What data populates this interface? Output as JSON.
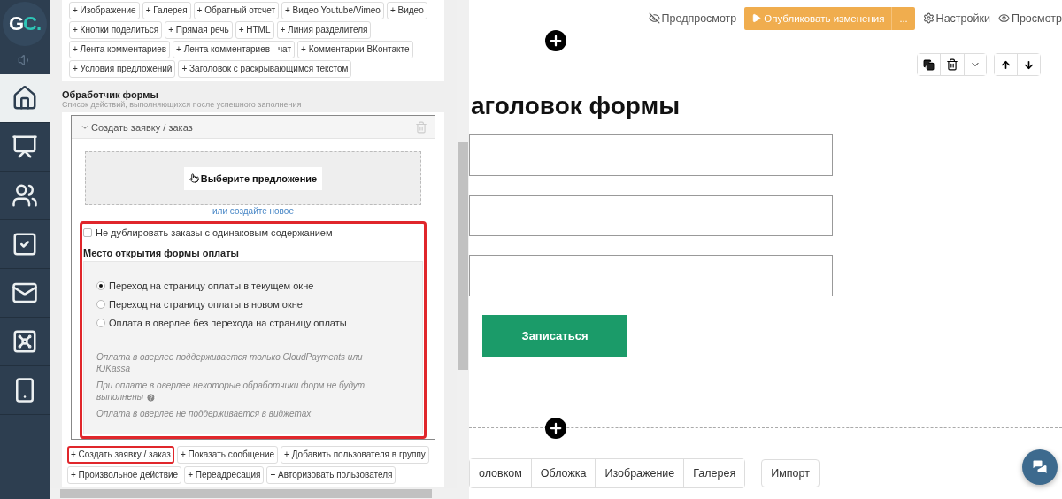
{
  "logo": {
    "text": "GC."
  },
  "nav": [
    {
      "selected": true
    },
    {
      "selected": false
    },
    {
      "selected": false
    },
    {
      "selected": false
    },
    {
      "selected": false
    },
    {
      "selected": false
    },
    {
      "selected": false
    }
  ],
  "block_buttons": [
    [
      "+ Изображение",
      "+ Галерея",
      "+ Обратный отсчет",
      "+ Видео Youtube/Vimeo",
      "+ Видео"
    ],
    [
      "+ Кнопки поделиться",
      "+ Прямая речь",
      "+ HTML",
      "+ Линия разделителя"
    ],
    [
      "+ Лента комментариев",
      "+ Лента комментариев - чат",
      "+ Комментарии ВКонтакте"
    ],
    [
      "+ Условия предложений",
      "+ Заголовок с раскрывающимся текстом"
    ]
  ],
  "form_handler": {
    "title": "Обработчик формы",
    "subtitle": "Список действий, выполняющихся после успешного заполнения",
    "action": {
      "title": "Создать заявку / заказ",
      "expanded": true,
      "choose_button": "Выберите предложение",
      "create_link": "или создайте новое",
      "settings": {
        "highlighted": true,
        "no_duplicates": {
          "label": "Не дублировать заказы с одинаковым содержанием",
          "checked": false
        },
        "payment_title": "Место открытия формы оплаты",
        "options": [
          {
            "label": "Переход на страницу оплаты в текущем окне",
            "selected": true
          },
          {
            "label": "Переход на страницу оплаты в новом окне",
            "selected": false
          },
          {
            "label": "Оплата в оверлее без перехода на страницу оплаты",
            "selected": false
          }
        ],
        "notes": [
          {
            "text": "Оплата в оверлее поддерживается только CloudPayments или ЮKassa",
            "help": false
          },
          {
            "text": "При оплате в оверлее некоторые обработчики форм не будут выполнены",
            "help": true
          },
          {
            "text": "Оплата в оверлее не поддерживается в виджетах",
            "help": false
          }
        ]
      }
    },
    "add_buttons": [
      [
        {
          "label": "+ Создать заявку / заказ",
          "highlighted": true
        },
        {
          "label": "+ Показать сообщение",
          "highlighted": false
        },
        {
          "label": "+ Добавить пользователя в группу",
          "highlighted": false
        }
      ],
      [
        {
          "label": "+ Произвольное действие",
          "highlighted": false
        },
        {
          "label": "+ Переадресация",
          "highlighted": false
        },
        {
          "label": "+ Авторизовать пользователя",
          "highlighted": false
        }
      ]
    ]
  },
  "topbar": {
    "preview": "Предпросмотр",
    "publish": "Опубликовать изменения",
    "publish_more": "...",
    "settings": "Настройки",
    "view": "Просмотр"
  },
  "form": {
    "heading": "аголовок формы",
    "submit": "Записаться"
  },
  "bottom_tabs": [
    "оловком",
    "Обложка",
    "Изображение",
    "Галерея"
  ],
  "import_button": "Импорт"
}
